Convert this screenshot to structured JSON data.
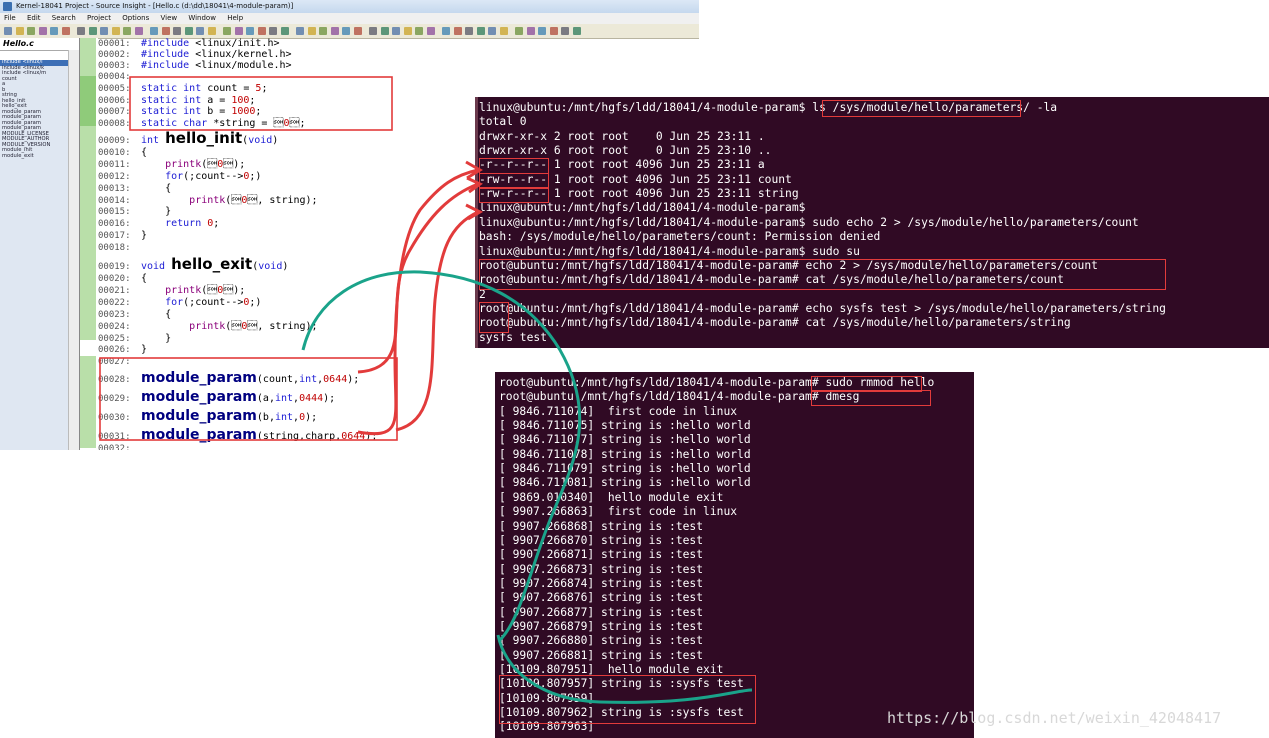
{
  "source_insight": {
    "title": "Kernel-18041 Project - Source Insight - [Hello.c (d:\\dd\\18041\\4-module-param)]",
    "menu": [
      "File",
      "Edit",
      "Search",
      "Project",
      "Options",
      "View",
      "Window",
      "Help"
    ],
    "file_tab": "Hello.c",
    "symbols": [
      "include <linux/i",
      "include <linux/k",
      "include <linux/m",
      "count",
      "a",
      "b",
      "string",
      "hello_init",
      "hello_exit",
      "module_param",
      "module_param",
      "module_param",
      "module_param",
      "MODULE_LICENSE",
      "MODULE_AUTHOR",
      "MODULE_VERSION",
      "module_init",
      "module_exit"
    ],
    "code": [
      {
        "n": "00001:",
        "t": "#include <linux/init.h>"
      },
      {
        "n": "00002:",
        "t": "#include <linux/kernel.h>"
      },
      {
        "n": "00003:",
        "t": "#include <linux/module.h>"
      },
      {
        "n": "00004:",
        "t": ""
      },
      {
        "n": "00005:",
        "t": "static int count = 5;"
      },
      {
        "n": "00006:",
        "t": "static int a = 100;"
      },
      {
        "n": "00007:",
        "t": "static int b = 1000;"
      },
      {
        "n": "00008:",
        "t": "static char *string = \"hello world\";"
      },
      {
        "n": "00009:",
        "t": "int hello_init(void)"
      },
      {
        "n": "00010:",
        "t": "{"
      },
      {
        "n": "00011:",
        "t": "    printk(\" first code in linux \\n\");"
      },
      {
        "n": "00012:",
        "t": "    for(;count-->0;)"
      },
      {
        "n": "00013:",
        "t": "    {"
      },
      {
        "n": "00014:",
        "t": "        printk(\"string is :%s\\n\", string);"
      },
      {
        "n": "00015:",
        "t": "    }"
      },
      {
        "n": "00016:",
        "t": "    return 0;"
      },
      {
        "n": "00017:",
        "t": "}"
      },
      {
        "n": "00018:",
        "t": ""
      },
      {
        "n": "00019:",
        "t": "void hello_exit(void)"
      },
      {
        "n": "00020:",
        "t": "{"
      },
      {
        "n": "00021:",
        "t": "    printk(\" hello module exit\\n\");"
      },
      {
        "n": "00022:",
        "t": "    for(;count-->0;)"
      },
      {
        "n": "00023:",
        "t": "    {"
      },
      {
        "n": "00024:",
        "t": "        printk(\"string is :%s\\n\", string);"
      },
      {
        "n": "00025:",
        "t": "    }"
      },
      {
        "n": "00026:",
        "t": "}"
      },
      {
        "n": "00027:",
        "t": ""
      },
      {
        "n": "00028:",
        "t": "module_param(count,int,0644);"
      },
      {
        "n": "00029:",
        "t": "module_param(a,int,0444);"
      },
      {
        "n": "00030:",
        "t": "module_param(b,int,0);"
      },
      {
        "n": "00031:",
        "t": "module_param(string,charp,0644);"
      },
      {
        "n": "00032:",
        "t": ""
      }
    ]
  },
  "terminal_top": {
    "lines": [
      "linux@ubuntu:/mnt/hgfs/ldd/18041/4-module-param$ ls /sys/module/hello/parameters/ -la",
      "total 0",
      "drwxr-xr-x 2 root root    0 Jun 25 23:11 .",
      "drwxr-xr-x 6 root root    0 Jun 25 23:10 ..",
      "-r--r--r-- 1 root root 4096 Jun 25 23:11 a",
      "-rw-r--r-- 1 root root 4096 Jun 25 23:11 count",
      "-rw-r--r-- 1 root root 4096 Jun 25 23:11 string",
      "linux@ubuntu:/mnt/hgfs/ldd/18041/4-module-param$",
      "linux@ubuntu:/mnt/hgfs/ldd/18041/4-module-param$ sudo echo 2 > /sys/module/hello/parameters/count",
      "bash: /sys/module/hello/parameters/count: Permission denied",
      "linux@ubuntu:/mnt/hgfs/ldd/18041/4-module-param$ sudo su",
      "root@ubuntu:/mnt/hgfs/ldd/18041/4-module-param# echo 2 > /sys/module/hello/parameters/count",
      "root@ubuntu:/mnt/hgfs/ldd/18041/4-module-param# cat /sys/module/hello/parameters/count",
      "2",
      "root@ubuntu:/mnt/hgfs/ldd/18041/4-module-param# echo sysfs test > /sys/module/hello/parameters/string",
      "root@ubuntu:/mnt/hgfs/ldd/18041/4-module-param# cat /sys/module/hello/parameters/string",
      "sysfs test"
    ]
  },
  "terminal_bottom": {
    "lines": [
      "root@ubuntu:/mnt/hgfs/ldd/18041/4-module-param# sudo rmmod hello",
      "root@ubuntu:/mnt/hgfs/ldd/18041/4-module-param# dmesg",
      "[ 9846.711074]  first code in linux",
      "[ 9846.711075] string is :hello world",
      "[ 9846.711077] string is :hello world",
      "[ 9846.711078] string is :hello world",
      "[ 9846.711079] string is :hello world",
      "[ 9846.711081] string is :hello world",
      "[ 9869.010340]  hello module exit",
      "[ 9907.266863]  first code in linux",
      "[ 9907.266868] string is :test",
      "[ 9907.266870] string is :test",
      "[ 9907.266871] string is :test",
      "[ 9907.266873] string is :test",
      "[ 9907.266874] string is :test",
      "[ 9907.266876] string is :test",
      "[ 9907.266877] string is :test",
      "[ 9907.266879] string is :test",
      "[ 9907.266880] string is :test",
      "[ 9907.266881] string is :test",
      "[10109.807951]  hello module exit",
      "[10109.807957] string is :sysfs test",
      "[10109.807959]",
      "[10109.807962] string is :sysfs test",
      "[10109.807963]"
    ]
  },
  "watermark": "https://blog.csdn.net/weixin_42048417",
  "colors": {
    "terminal_bg": "#300a24",
    "annotation_red": "#e23b3b",
    "annotation_green": "#1aa38a",
    "gutter_green": "#b9dfa9"
  }
}
